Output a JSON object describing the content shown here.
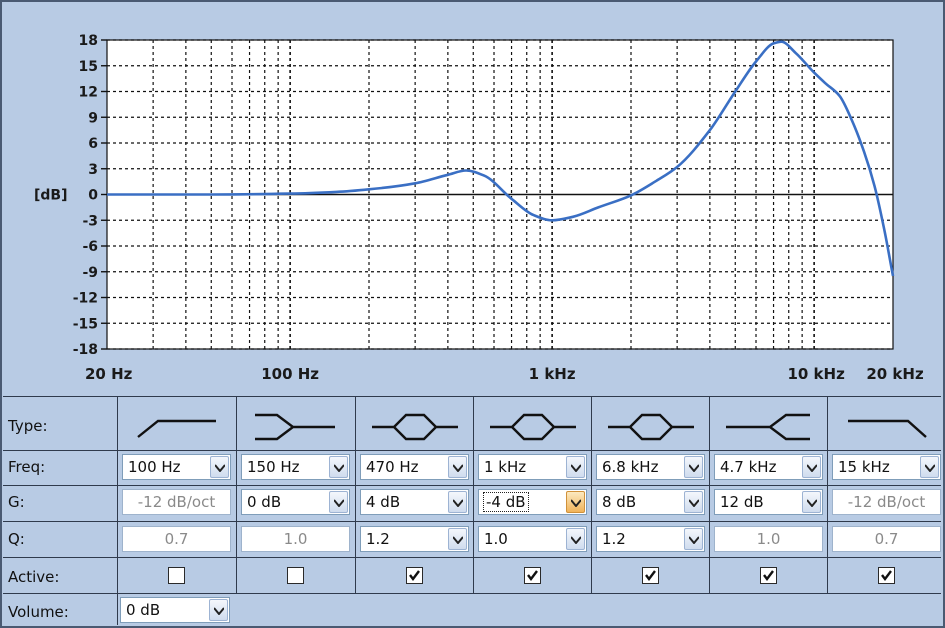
{
  "chart_data": {
    "type": "line",
    "ylabel": "[dB]",
    "ylim": [
      -18,
      18
    ],
    "yticks": [
      "18",
      "15",
      "12",
      "9",
      "6",
      "3",
      "0",
      "-3",
      "-6",
      "-9",
      "-12",
      "-15",
      "-18"
    ],
    "x_scale": "log",
    "xlim": [
      20,
      20000
    ],
    "xtick_labels": [
      {
        "freq": 20,
        "label": "20 Hz"
      },
      {
        "freq": 100,
        "label": "100 Hz"
      },
      {
        "freq": 1000,
        "label": "1 kHz"
      },
      {
        "freq": 10000,
        "label": "10 kHz"
      },
      {
        "freq": 20000,
        "label": "20 kHz"
      }
    ],
    "grid": true,
    "line_color": "#3a6fc4",
    "series": [
      {
        "x": [
          20,
          50,
          100,
          150,
          200,
          300,
          400,
          470,
          550,
          700,
          850,
          1000,
          1200,
          1500,
          2000,
          2500,
          3000,
          4000,
          5000,
          6000,
          7000,
          7500,
          8500,
          10000,
          11000,
          12500,
          14000,
          15500,
          17000,
          18500,
          20000
        ],
        "y": [
          0,
          0,
          0.1,
          0.3,
          0.6,
          1.3,
          2.3,
          2.8,
          2.2,
          -0.5,
          -2.4,
          -3.0,
          -2.6,
          -1.5,
          -0.1,
          1.6,
          3.2,
          7.5,
          12.0,
          15.5,
          17.6,
          17.8,
          16.5,
          14.2,
          13.0,
          11.5,
          8.5,
          5.0,
          1.0,
          -4.0,
          -9.5
        ]
      }
    ]
  },
  "labels": {
    "type": "Type:",
    "freq": "Freq:",
    "gain": "G:",
    "q": "Q:",
    "active": "Active:",
    "volume": "Volume:"
  },
  "bands": [
    {
      "type_icon": "high-pass-filter-icon",
      "freq": "100 Hz",
      "gain": "-12 dB/oct",
      "gain_editable": false,
      "q": "0.7",
      "q_editable": false,
      "active": false
    },
    {
      "type_icon": "low-shelf-filter-icon",
      "freq": "150 Hz",
      "gain": "0 dB",
      "gain_editable": true,
      "q": "1.0",
      "q_editable": false,
      "active": false
    },
    {
      "type_icon": "peaking-filter-icon",
      "freq": "470 Hz",
      "gain": "4 dB",
      "gain_editable": true,
      "q": "1.2",
      "q_editable": true,
      "active": true
    },
    {
      "type_icon": "peaking-filter-icon",
      "freq": "1 kHz",
      "gain": "-4 dB",
      "gain_editable": true,
      "gain_focused": true,
      "q": "1.0",
      "q_editable": true,
      "active": true
    },
    {
      "type_icon": "peaking-filter-icon",
      "freq": "6.8 kHz",
      "gain": "8 dB",
      "gain_editable": true,
      "q": "1.2",
      "q_editable": true,
      "active": true
    },
    {
      "type_icon": "high-shelf-filter-icon",
      "freq": "4.7 kHz",
      "gain": "12 dB",
      "gain_editable": true,
      "q": "1.0",
      "q_editable": false,
      "active": true
    },
    {
      "type_icon": "low-pass-filter-icon",
      "freq": "15 kHz",
      "gain": "-12 dB/oct",
      "gain_editable": false,
      "q": "0.7",
      "q_editable": false,
      "active": true
    }
  ],
  "volume": {
    "value": "0 dB"
  }
}
